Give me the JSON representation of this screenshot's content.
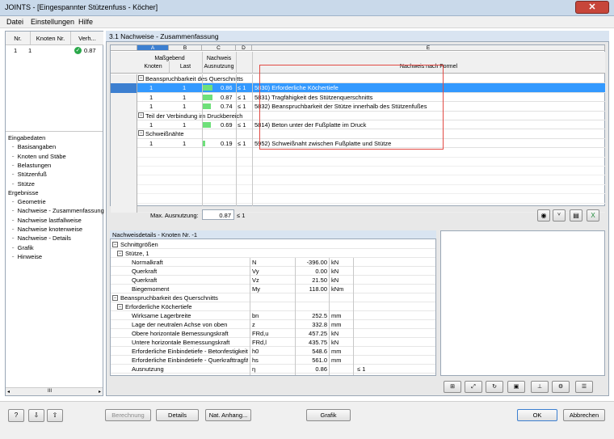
{
  "window": {
    "title": "JOINTS - [Eingespannter Stützenfuss - Köcher]",
    "close_glyph": "✕"
  },
  "menu": [
    "Datei",
    "Einstellungen",
    "Hilfe"
  ],
  "left": {
    "headers": [
      "Nr.",
      "Knoten Nr.",
      "Verh..."
    ],
    "row": {
      "nr": "1",
      "knoten": "1",
      "verh": "0.87"
    },
    "tree": [
      {
        "label": "Eingabedaten",
        "level": 0
      },
      {
        "label": "Basisangaben",
        "level": 1
      },
      {
        "label": "Knoten und Stäbe",
        "level": 1
      },
      {
        "label": "Belastungen",
        "level": 1
      },
      {
        "label": "Stützenfuß",
        "level": 1
      },
      {
        "label": "Stütze",
        "level": 1
      },
      {
        "label": "Ergebnisse",
        "level": 0
      },
      {
        "label": "Geometrie",
        "level": 1
      },
      {
        "label": "Nachweise - Zusammenfassung",
        "level": 1
      },
      {
        "label": "Nachweise lastfallweise",
        "level": 1
      },
      {
        "label": "Nachweise knotenweise",
        "level": 1
      },
      {
        "label": "Nachweise - Details",
        "level": 1
      },
      {
        "label": "Grafik",
        "level": 1
      },
      {
        "label": "Hinweise",
        "level": 1
      }
    ],
    "scroll_label": "III"
  },
  "section_title": "3.1 Nachweise - Zusammenfassung",
  "grid": {
    "col_letters": [
      "A",
      "B",
      "C",
      "D",
      "E"
    ],
    "hdr": {
      "massgebend": "Maßgebend",
      "knoten": "Knoten",
      "last": "Last",
      "nachweis": "Nachweis",
      "ausnutzung": "Ausnutzung",
      "nach_formel": "Nachweis nach Formel"
    },
    "groups": [
      {
        "title": "Beanspruchbarkeit des Querschnitts",
        "rows": [
          {
            "knoten": "1",
            "last": "1",
            "ausn": "0.86",
            "le": "≤ 1",
            "formel": "5830) Erforderliche Köchertiefe",
            "fill": 0.86
          },
          {
            "knoten": "1",
            "last": "1",
            "ausn": "0.87",
            "le": "≤ 1",
            "formel": "5831) Tragfähigkeit des Stützenquerschnitts",
            "fill": 0.87
          },
          {
            "knoten": "1",
            "last": "1",
            "ausn": "0.74",
            "le": "≤ 1",
            "formel": "5832) Beanspruchbarkeit der Stütze innerhalb des Stützenfußes",
            "fill": 0.74
          }
        ]
      },
      {
        "title": "Teil der Verbindung im Druckbereich",
        "rows": [
          {
            "knoten": "1",
            "last": "1",
            "ausn": "0.69",
            "le": "≤ 1",
            "formel": "5814) Beton unter der Fußplatte im Druck",
            "fill": 0.69
          }
        ]
      },
      {
        "title": "Schweißnähte",
        "rows": [
          {
            "knoten": "1",
            "last": "1",
            "ausn": "0.19",
            "le": "≤ 1",
            "formel": "5952) Schweißnaht zwischen Fußplatte und Stütze",
            "fill": 0.19
          }
        ]
      }
    ],
    "max_label": "Max. Ausnutzung:",
    "max_value": "0.87",
    "max_le": "≤ 1"
  },
  "details": {
    "title": "Nachweisdetails - Knoten Nr. -1",
    "rows": [
      {
        "type": "group",
        "label": "Schnittgrößen"
      },
      {
        "type": "sub",
        "label": "Stütze, 1"
      },
      {
        "type": "data",
        "label": "Normalkraft",
        "sym": "N",
        "val": "-396.00",
        "unit": "kN"
      },
      {
        "type": "data",
        "label": "Querkraft",
        "sym": "Vy",
        "val": "0.00",
        "unit": "kN"
      },
      {
        "type": "data",
        "label": "Querkraft",
        "sym": "Vz",
        "val": "21.50",
        "unit": "kN"
      },
      {
        "type": "data",
        "label": "Biegemoment",
        "sym": "My",
        "val": "118.00",
        "unit": "kNm"
      },
      {
        "type": "group",
        "label": "Beanspruchbarkeit des Querschnitts"
      },
      {
        "type": "sub",
        "label": "Erforderliche Köchertiefe"
      },
      {
        "type": "data",
        "label": "Wirksame Lagerbreite",
        "sym": "bn",
        "val": "252.5",
        "unit": "mm"
      },
      {
        "type": "data",
        "label": "Lage der neutralen Achse von oben",
        "sym": "z",
        "val": "332.8",
        "unit": "mm"
      },
      {
        "type": "data",
        "label": "Obere horizontale Bemessungskraft",
        "sym": "FRd,u",
        "val": "457.25",
        "unit": "kN"
      },
      {
        "type": "data",
        "label": "Untere horizontale Bemessungskraft",
        "sym": "FRd,l",
        "val": "435.75",
        "unit": "kN"
      },
      {
        "type": "data",
        "label": "Erforderliche Einbindetiefe - Betonfestigkeit",
        "sym": "h0",
        "val": "548.6",
        "unit": "mm"
      },
      {
        "type": "data",
        "label": "Erforderliche Einbindetiefe - Querkrafttragfä",
        "sym": "hs",
        "val": "561.0",
        "unit": "mm"
      },
      {
        "type": "data",
        "label": "Ausnutzung",
        "sym": "η",
        "val": "0.86",
        "unit": "",
        "extra": "≤ 1"
      }
    ]
  },
  "bottom": {
    "berechnung": "Berechnung",
    "details": "Details",
    "nat_anhang": "Nat. Anhang...",
    "grafik": "Grafik",
    "ok": "OK",
    "abbrechen": "Abbrechen"
  },
  "colors": {
    "selection": "#3399ff",
    "bar": "#6ee07a",
    "redbox": "#e24a44",
    "check": "#2aa84a"
  }
}
